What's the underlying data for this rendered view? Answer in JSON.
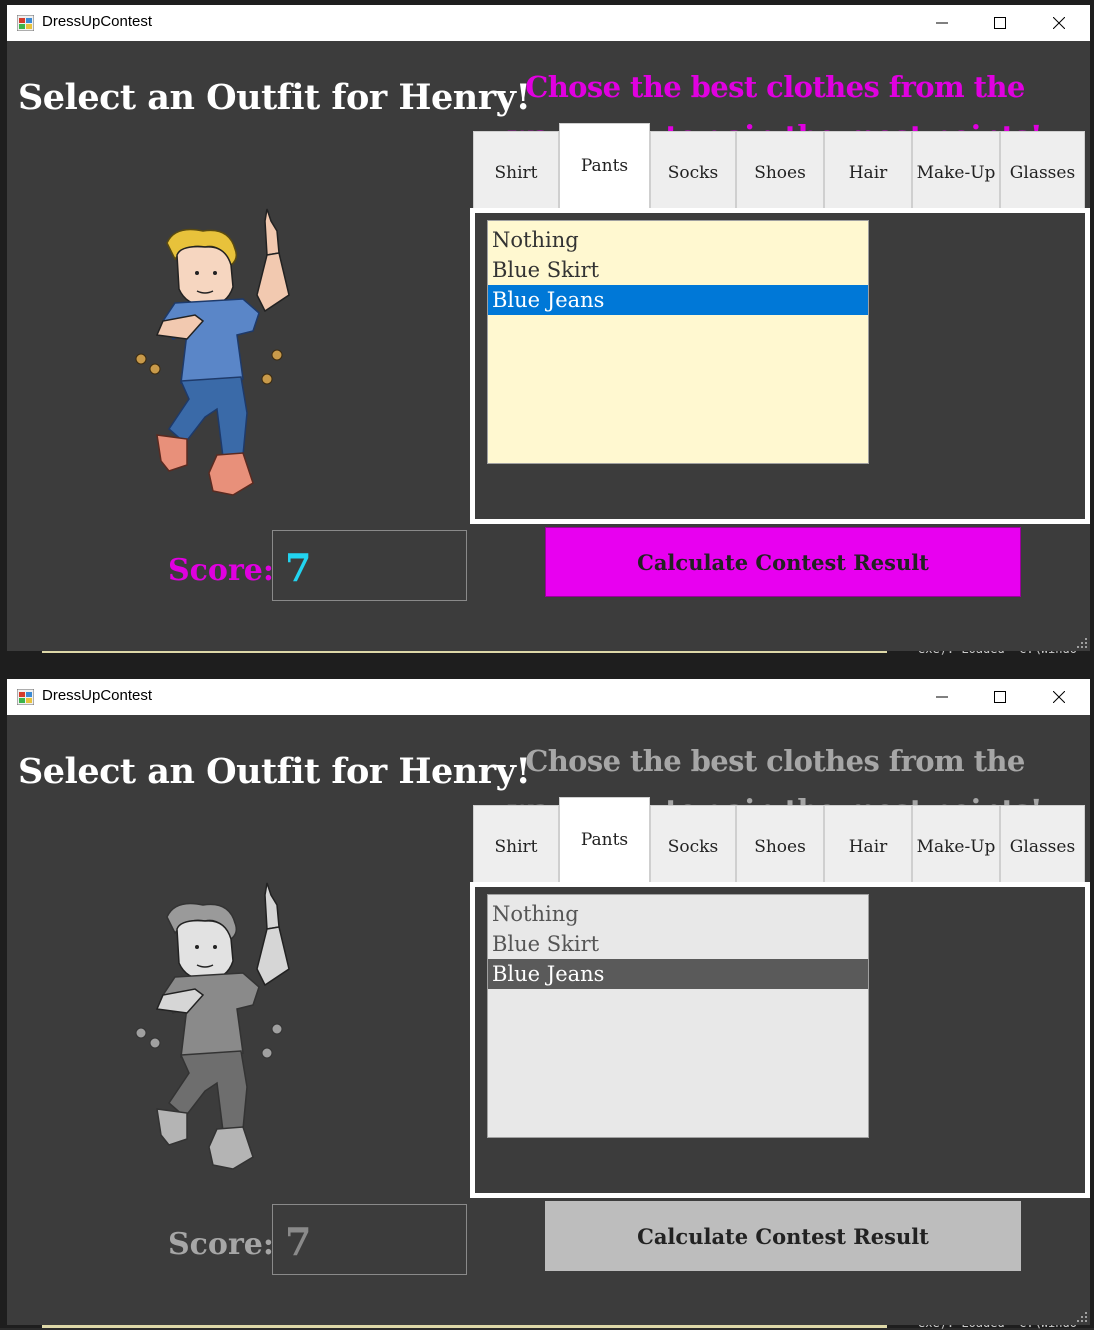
{
  "windows": [
    {
      "state": "enabled",
      "title": "DressUpContest",
      "heading": "Select an Outfit for Henry!",
      "subtitle": "Chose the best clothes from the wardrobe to gain the most points!",
      "tabs": [
        "Shirt",
        "Pants",
        "Socks",
        "Shoes",
        "Hair",
        "Make-Up",
        "Glasses"
      ],
      "active_tab": "Pants",
      "list_items": [
        "Nothing",
        "Blue Skirt",
        "Blue Jeans"
      ],
      "selected_item": "Blue Jeans",
      "score_label": "Score:",
      "score_value": "7",
      "calc_button": "Calculate Contest Result",
      "colors": {
        "subtitle": "#e000e0",
        "score_label": "#e000e0",
        "score_value": "#22d4f0",
        "button_bg": "#e800f0",
        "button_border": "#9a009a",
        "list_bg": "#fff8d0",
        "selection_bg": "#0078d7",
        "selection_fg": "#ffffff"
      }
    },
    {
      "state": "disabled",
      "title": "DressUpContest",
      "heading": "Select an Outfit for Henry!",
      "subtitle": "Chose the best clothes from the wardrobe to gain the most points!",
      "tabs": [
        "Shirt",
        "Pants",
        "Socks",
        "Shoes",
        "Hair",
        "Make-Up",
        "Glasses"
      ],
      "active_tab": "Pants",
      "list_items": [
        "Nothing",
        "Blue Skirt",
        "Blue Jeans"
      ],
      "selected_item": "Blue Jeans",
      "score_label": "Score:",
      "score_value": "7",
      "calc_button": "Calculate Contest Result",
      "colors": {
        "subtitle": "#a6a6a6",
        "score_label": "#a6a6a6",
        "score_value": "#8a8a8a",
        "button_bg": "#bdbdbd",
        "button_border": "#bdbdbd",
        "list_bg": "#e8e8e8",
        "selection_bg": "#5a5a5a",
        "selection_fg": "#ffffff"
      }
    }
  ],
  "background_status_text": "exe): Loaded  'C:\\Windo"
}
